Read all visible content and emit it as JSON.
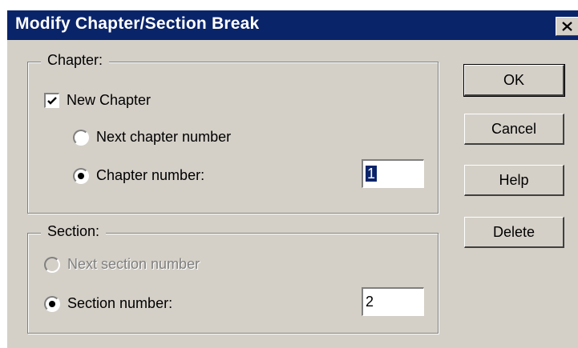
{
  "dialog": {
    "title": "Modify Chapter/Section Break"
  },
  "chapter": {
    "group_label": "Chapter:",
    "new_chapter_label": "New Chapter",
    "new_chapter_checked": true,
    "next_chapter_label": "Next chapter number",
    "chapter_number_label": "Chapter number:",
    "chapter_number_value": "1",
    "selected_option": "chapter-number"
  },
  "section": {
    "group_label": "Section:",
    "next_section_label": "Next section number",
    "next_section_disabled": true,
    "section_number_label": "Section number:",
    "section_number_value": "2",
    "selected_option": "section-number"
  },
  "buttons": {
    "ok": "OK",
    "cancel": "Cancel",
    "help": "Help",
    "delete": "Delete"
  },
  "icons": {
    "close": "close-icon",
    "check": "check-icon"
  },
  "colors": {
    "titlebar": "#0a246a",
    "face": "#d4d0c8",
    "disabled_text": "#808080"
  }
}
